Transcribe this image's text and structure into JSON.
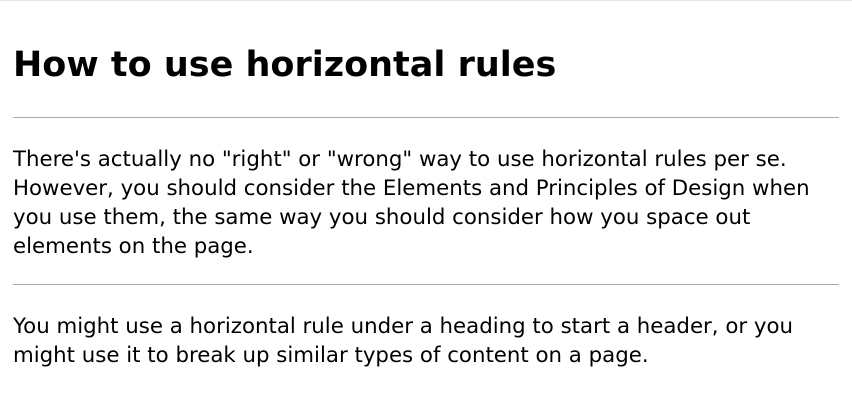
{
  "article": {
    "heading": "How to use horizontal rules",
    "paragraphs": [
      "There's actually no \"right\" or \"wrong\" way to use horizontal rules per se. However, you should consider the Elements and Principles of Design when you use them, the same way you should consider how you space out elements on the page.",
      "You might use a horizontal rule under a heading to start a header, or you might use it to break up similar types of content on a page."
    ]
  },
  "colors": {
    "background": "#ffffff",
    "text": "#000000",
    "rule": "#a8a8a8"
  }
}
